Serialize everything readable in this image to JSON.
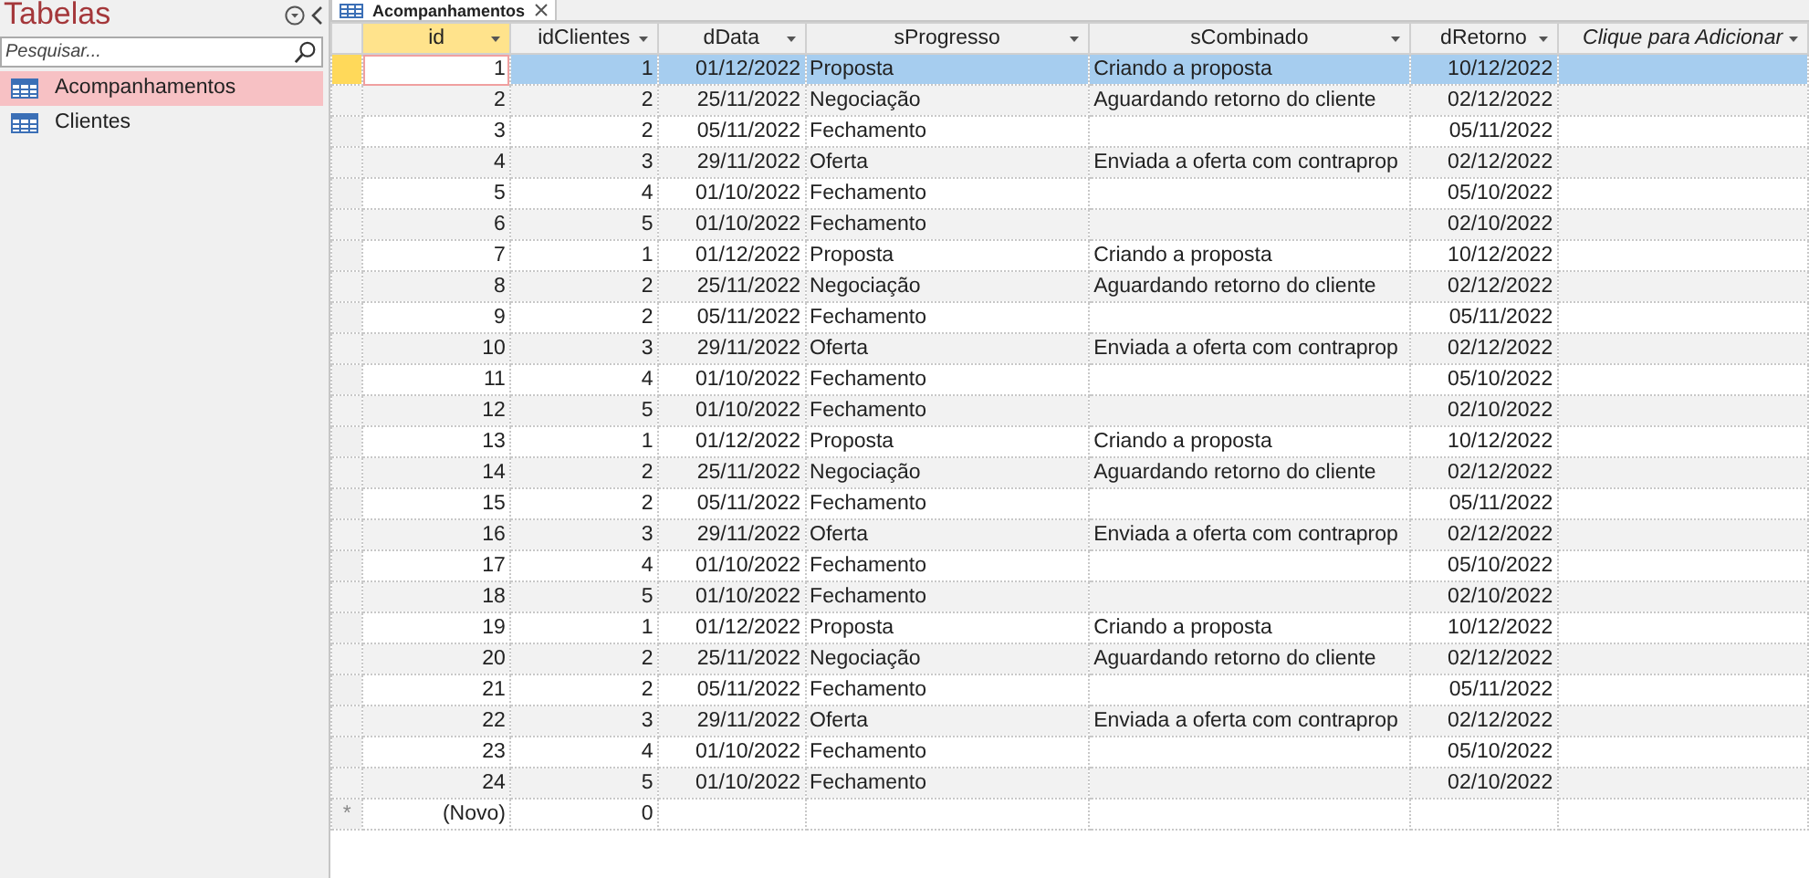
{
  "sidebar": {
    "title": "Tabelas",
    "search": {
      "placeholder": "Pesquisar..."
    },
    "items": [
      {
        "label": "Acompanhamentos",
        "selected": true
      },
      {
        "label": "Clientes",
        "selected": false
      }
    ]
  },
  "tab": {
    "label": "Acompanhamentos"
  },
  "table": {
    "columns": [
      {
        "label": "id",
        "kind": "field",
        "selected": true
      },
      {
        "label": "idClientes",
        "kind": "field",
        "selected": false
      },
      {
        "label": "dData",
        "kind": "field",
        "selected": false
      },
      {
        "label": "sProgresso",
        "kind": "field",
        "selected": false
      },
      {
        "label": "sCombinado",
        "kind": "field",
        "selected": false
      },
      {
        "label": "dRetorno",
        "kind": "field",
        "selected": false
      },
      {
        "label": "Clique para Adicionar",
        "kind": "add",
        "selected": false
      }
    ],
    "rows": [
      {
        "selected": true,
        "cells": [
          "1",
          "1",
          "01/12/2022",
          "Proposta",
          "Criando a proposta",
          "10/12/2022"
        ]
      },
      {
        "selected": false,
        "cells": [
          "2",
          "2",
          "25/11/2022",
          "Negociação",
          "Aguardando retorno do cliente",
          "02/12/2022"
        ]
      },
      {
        "selected": false,
        "cells": [
          "3",
          "2",
          "05/11/2022",
          "Fechamento",
          "",
          "05/11/2022"
        ]
      },
      {
        "selected": false,
        "cells": [
          "4",
          "3",
          "29/11/2022",
          "Oferta",
          "Enviada a oferta com contraprop",
          "02/12/2022"
        ]
      },
      {
        "selected": false,
        "cells": [
          "5",
          "4",
          "01/10/2022",
          "Fechamento",
          "",
          "05/10/2022"
        ]
      },
      {
        "selected": false,
        "cells": [
          "6",
          "5",
          "01/10/2022",
          "Fechamento",
          "",
          "02/10/2022"
        ]
      },
      {
        "selected": false,
        "cells": [
          "7",
          "1",
          "01/12/2022",
          "Proposta",
          "Criando a proposta",
          "10/12/2022"
        ]
      },
      {
        "selected": false,
        "cells": [
          "8",
          "2",
          "25/11/2022",
          "Negociação",
          "Aguardando retorno do cliente",
          "02/12/2022"
        ]
      },
      {
        "selected": false,
        "cells": [
          "9",
          "2",
          "05/11/2022",
          "Fechamento",
          "",
          "05/11/2022"
        ]
      },
      {
        "selected": false,
        "cells": [
          "10",
          "3",
          "29/11/2022",
          "Oferta",
          "Enviada a oferta com contraprop",
          "02/12/2022"
        ]
      },
      {
        "selected": false,
        "cells": [
          "11",
          "4",
          "01/10/2022",
          "Fechamento",
          "",
          "05/10/2022"
        ]
      },
      {
        "selected": false,
        "cells": [
          "12",
          "5",
          "01/10/2022",
          "Fechamento",
          "",
          "02/10/2022"
        ]
      },
      {
        "selected": false,
        "cells": [
          "13",
          "1",
          "01/12/2022",
          "Proposta",
          "Criando a proposta",
          "10/12/2022"
        ]
      },
      {
        "selected": false,
        "cells": [
          "14",
          "2",
          "25/11/2022",
          "Negociação",
          "Aguardando retorno do cliente",
          "02/12/2022"
        ]
      },
      {
        "selected": false,
        "cells": [
          "15",
          "2",
          "05/11/2022",
          "Fechamento",
          "",
          "05/11/2022"
        ]
      },
      {
        "selected": false,
        "cells": [
          "16",
          "3",
          "29/11/2022",
          "Oferta",
          "Enviada a oferta com contraprop",
          "02/12/2022"
        ]
      },
      {
        "selected": false,
        "cells": [
          "17",
          "4",
          "01/10/2022",
          "Fechamento",
          "",
          "05/10/2022"
        ]
      },
      {
        "selected": false,
        "cells": [
          "18",
          "5",
          "01/10/2022",
          "Fechamento",
          "",
          "02/10/2022"
        ]
      },
      {
        "selected": false,
        "cells": [
          "19",
          "1",
          "01/12/2022",
          "Proposta",
          "Criando a proposta",
          "10/12/2022"
        ]
      },
      {
        "selected": false,
        "cells": [
          "20",
          "2",
          "25/11/2022",
          "Negociação",
          "Aguardando retorno do cliente",
          "02/12/2022"
        ]
      },
      {
        "selected": false,
        "cells": [
          "21",
          "2",
          "05/11/2022",
          "Fechamento",
          "",
          "05/11/2022"
        ]
      },
      {
        "selected": false,
        "cells": [
          "22",
          "3",
          "29/11/2022",
          "Oferta",
          "Enviada a oferta com contraprop",
          "02/12/2022"
        ]
      },
      {
        "selected": false,
        "cells": [
          "23",
          "4",
          "01/10/2022",
          "Fechamento",
          "",
          "05/10/2022"
        ]
      },
      {
        "selected": false,
        "cells": [
          "24",
          "5",
          "01/10/2022",
          "Fechamento",
          "",
          "02/10/2022"
        ]
      }
    ],
    "new_row": {
      "marker": "*",
      "cells": [
        "(Novo)",
        "0"
      ]
    }
  }
}
